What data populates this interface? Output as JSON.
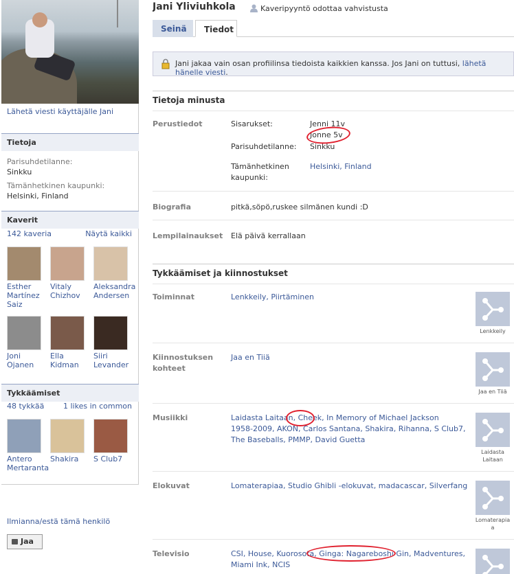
{
  "profile": {
    "name": "Jani Yliviuhkola",
    "pending_text": "Kaveripyyntö odottaa vahvistusta",
    "send_message_link": "Lähetä viesti käyttäjälle Jani"
  },
  "tabs": [
    {
      "label": "Seinä"
    },
    {
      "label": "Tiedot"
    }
  ],
  "info_box": {
    "title": "Tietoja",
    "relationship_label": "Parisuhdetilanne:",
    "relationship_value": "Sinkku",
    "city_label": "Tämänhetkinen kaupunki:",
    "city_value": "Helsinki, Finland"
  },
  "friends_box": {
    "title": "Kaverit",
    "count": "142 kaveria",
    "see_all": "Näytä kaikki",
    "friends": [
      {
        "name": "Esther Martínez Saiz",
        "color": "#a38a6e"
      },
      {
        "name": "Vitaly Chizhov",
        "color": "#c8a48d"
      },
      {
        "name": "Aleksandra Andersen",
        "color": "#d8c2a8"
      },
      {
        "name": "Joni Ojanen",
        "color": "#8c8c8c"
      },
      {
        "name": "Ella Kidman",
        "color": "#7a5a4a"
      },
      {
        "name": "Siiri Levander",
        "color": "#3a2a22"
      }
    ]
  },
  "likes_box": {
    "title": "Tykkäämiset",
    "count": "48 tykkää",
    "common": "1 likes in common",
    "items": [
      {
        "name": "Antero Mertaranta",
        "color": "#8fa0b8"
      },
      {
        "name": "Shakira",
        "color": "#d9c29a"
      },
      {
        "name": "S Club7",
        "color": "#9a5a44"
      }
    ]
  },
  "report_link": "Ilmianna/estä tämä henkilö",
  "share_button": "Jaa",
  "notice": {
    "text": "Jani jakaa vain osan profiilinsa tiedoista kaikkien kanssa. Jos Jani on tuttusi, ",
    "link": "lähetä hänelle viesti",
    "end": "."
  },
  "about": {
    "title": "Tietoja minusta",
    "basic_label": "Perustiedot",
    "siblings_label": "Sisarukset:",
    "sibling1": "Jenni 11v",
    "sibling2": "Jonne 5v",
    "relationship_label": "Parisuhdetilanne:",
    "relationship_value": "Sinkku",
    "city_label_1": "Tämänhetkinen",
    "city_label_2": "kaupunki:",
    "city_value": "Helsinki, Finland",
    "bio_label": "Biografia",
    "bio_value": "pitkä,söpö,ruskee silmänen kundi :D",
    "quote_label": "Lempilainaukset",
    "quote_value": "Elä päivä kerrallaan"
  },
  "likes_section": {
    "title": "Tykkäämiset ja kiinnostukset",
    "activities_label": "Toiminnat",
    "activities_value": "Lenkkeily, Piirtäminen",
    "activities_thumb": "Lenkkeily",
    "interests_label_1": "Kiinnostuksen",
    "interests_label_2": "kohteet",
    "interests_value": "Jaa en Tiiä",
    "interests_thumb": "Jaa en Tiiä",
    "music_label": "Musiikki",
    "music_line1": "Laidasta Laitaan, Cheek, In Memory of Michael Jackson",
    "music_line2": "1958-2009, AKON, Carlos Santana, Shakira, Rihanna, S Club7,",
    "music_line3": "The Baseballs, PMMP, David Guetta",
    "music_thumb_1": "Laidasta",
    "music_thumb_2": "Laitaan",
    "movies_label": "Elokuvat",
    "movies_value": "Lomaterapiaa, Studio Ghibli -elokuvat, madacascar, Silverfang",
    "movies_thumb_1": "Lomaterapia",
    "movies_thumb_2": "a",
    "tv_label": "Televisio",
    "tv_line1": "CSI, House, Kuorosota, Ginga: Nagareboshi Gin, Madventures,",
    "tv_line2": "Miami Ink, NCIS"
  }
}
